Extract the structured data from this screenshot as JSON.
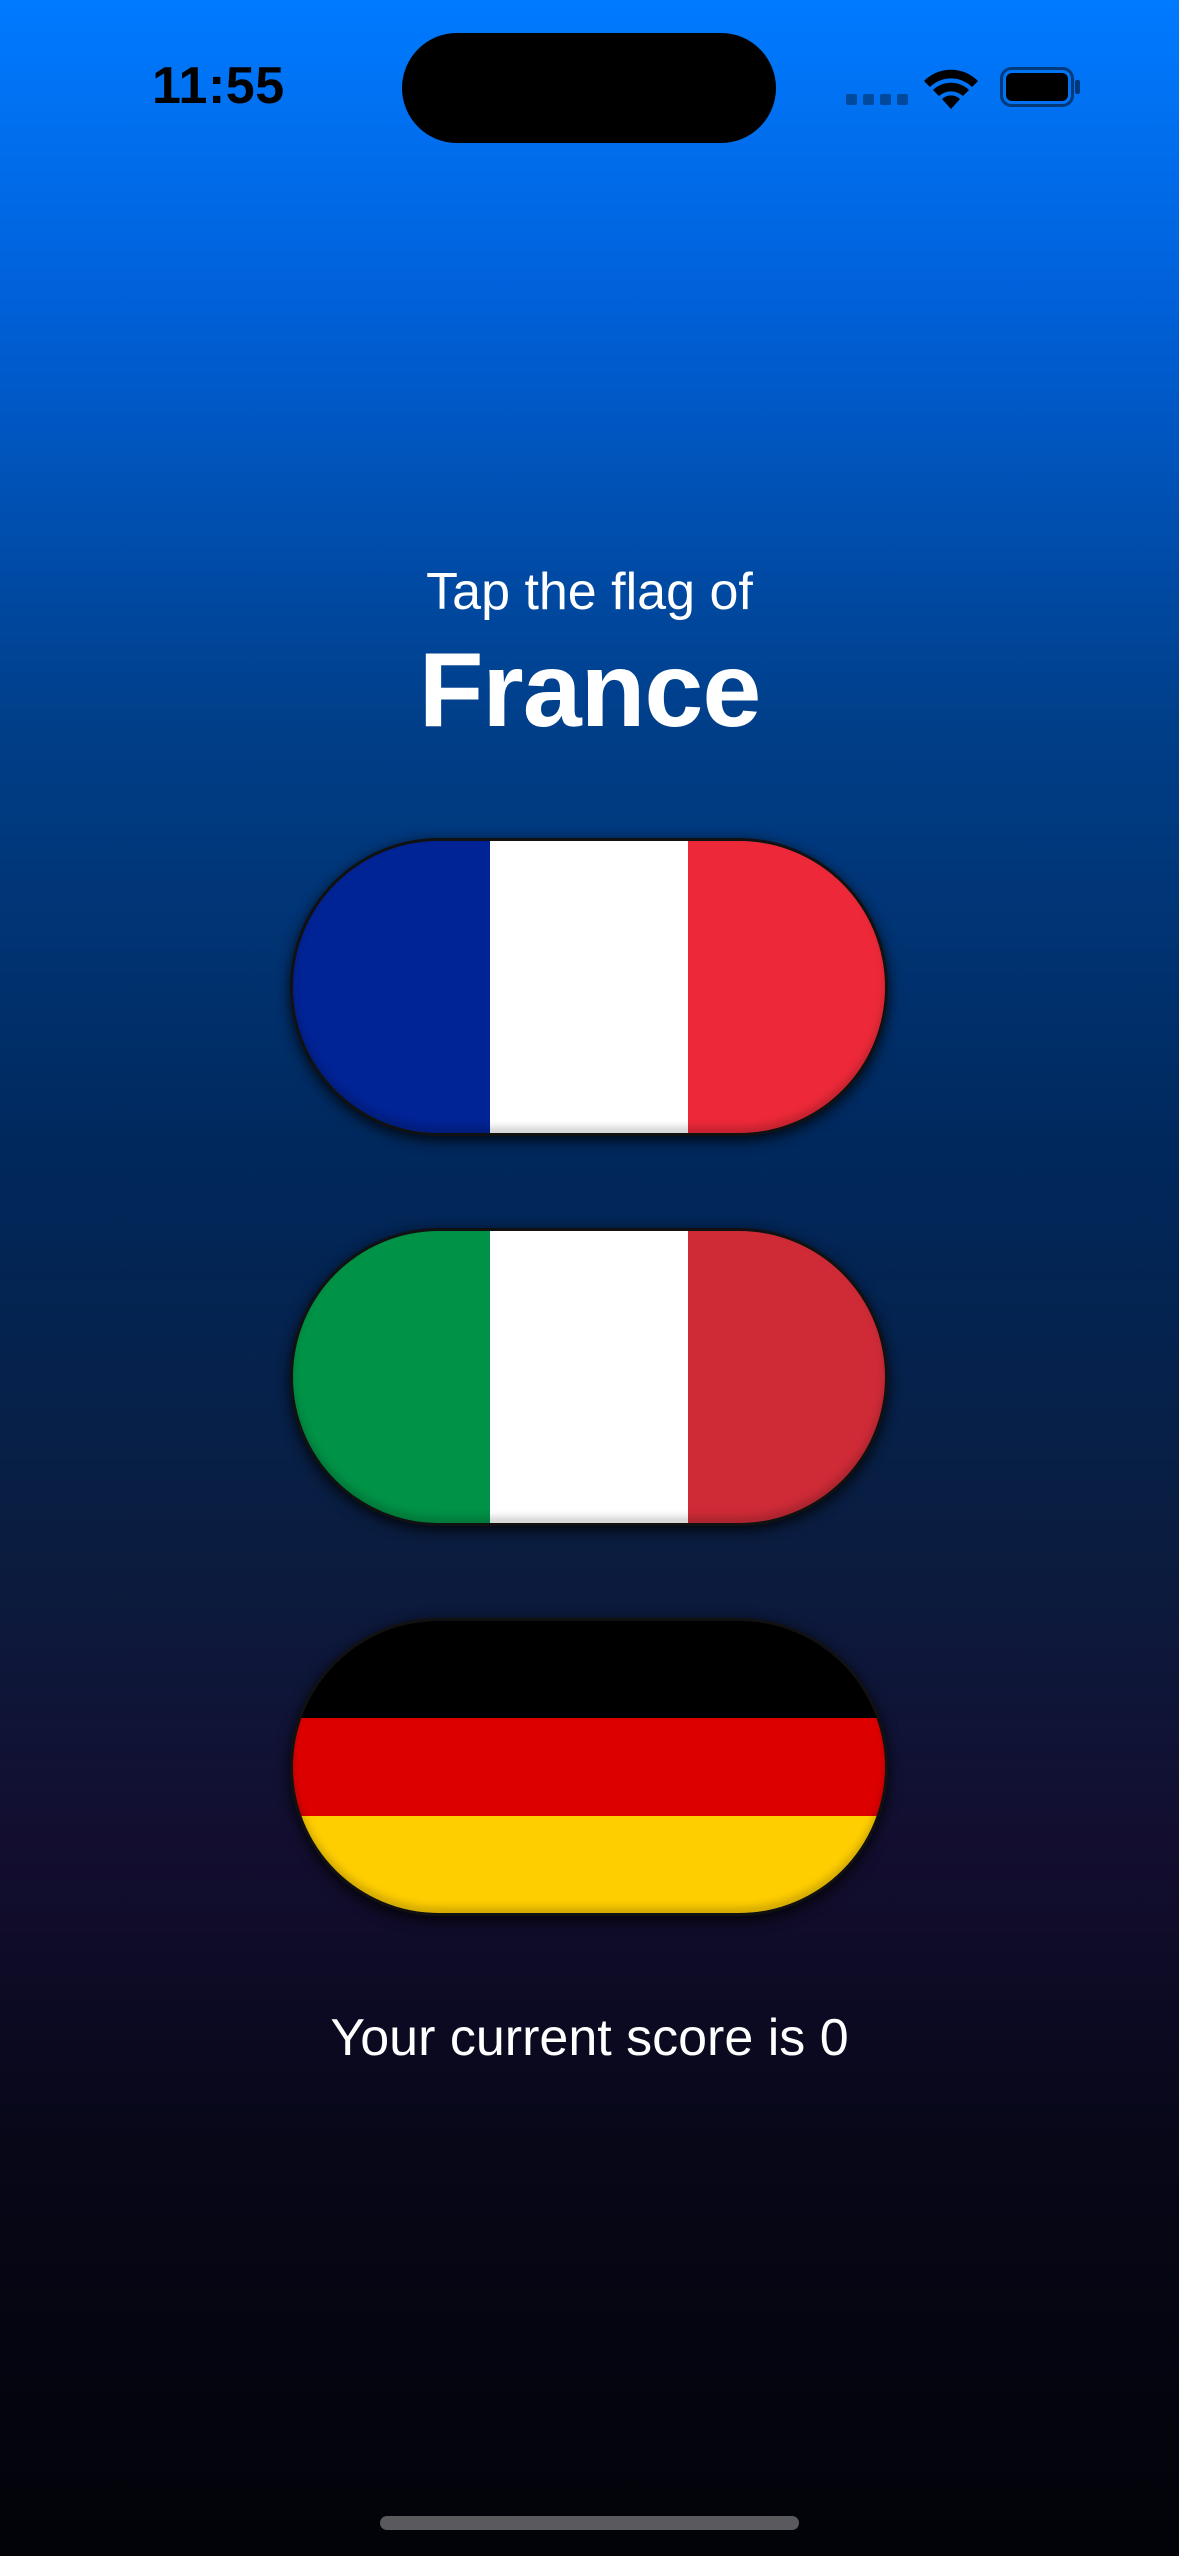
{
  "status_bar": {
    "time": "11:55"
  },
  "game": {
    "prompt": "Tap the flag of",
    "country": "France",
    "score_text": "Your current score is 0"
  },
  "flags": [
    {
      "name": "France",
      "orientation": "vertical",
      "stripes": [
        "#002395",
        "#ffffff",
        "#ed2939"
      ]
    },
    {
      "name": "Italy",
      "orientation": "vertical",
      "stripes": [
        "#009246",
        "#ffffff",
        "#ce2b37"
      ]
    },
    {
      "name": "Germany",
      "orientation": "horizontal",
      "stripes": [
        "#000000",
        "#dd0000",
        "#ffce00"
      ]
    }
  ]
}
